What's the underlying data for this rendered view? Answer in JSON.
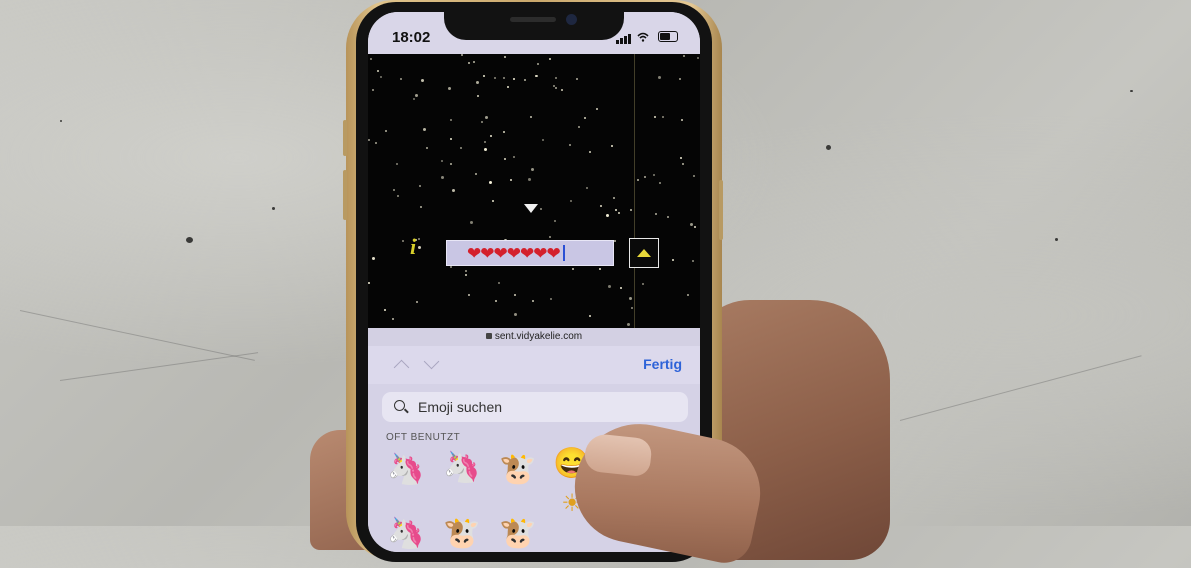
{
  "status_bar": {
    "time": "18:02"
  },
  "game": {
    "answer_text": "❤❤❤❤❤❤❤",
    "info_glyph": "i"
  },
  "browser": {
    "url": "sent.vidyakelie.com"
  },
  "keyboard_toolbar": {
    "done_label": "Fertig"
  },
  "emoji_keyboard": {
    "search_placeholder": "Emoji suchen",
    "section_label": "OFT BENUTZT"
  },
  "colors": {
    "hearts": "#d4202c",
    "done_link": "#2e63d8",
    "info_glyph": "#d8cf2a",
    "submit_arrow": "#e8d83a"
  },
  "icons": [
    "lock-icon",
    "search-icon",
    "chevron-up-icon",
    "chevron-down-icon",
    "signal-icon",
    "wifi-icon",
    "battery-icon",
    "submit-arrow-icon",
    "down-arrow-icon"
  ]
}
